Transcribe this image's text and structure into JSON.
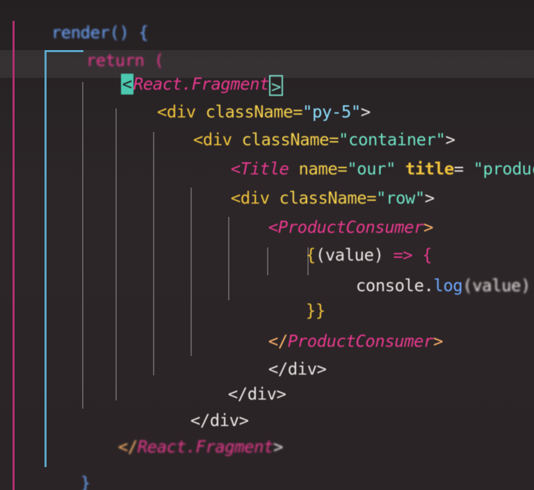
{
  "editor": {
    "lines": [
      {
        "id": "l1",
        "text": "render() {"
      },
      {
        "id": "l2",
        "text": "return ("
      },
      {
        "id": "l3a",
        "text": "<"
      },
      {
        "id": "l3b",
        "text": "React.Fragment"
      },
      {
        "id": "l3c",
        "text": ">"
      },
      {
        "id": "l4a",
        "text": "<div "
      },
      {
        "id": "l4b",
        "text": "className="
      },
      {
        "id": "l4c",
        "text": "\"py-5\""
      },
      {
        "id": "l4d",
        "text": ">"
      },
      {
        "id": "l5a",
        "text": "<div "
      },
      {
        "id": "l5b",
        "text": "className="
      },
      {
        "id": "l5c",
        "text": "\"container\""
      },
      {
        "id": "l5d",
        "text": ">"
      },
      {
        "id": "l6a",
        "text": "<"
      },
      {
        "id": "l6b",
        "text": "Title "
      },
      {
        "id": "l6c",
        "text": "name="
      },
      {
        "id": "l6d",
        "text": "\"our\""
      },
      {
        "id": "l6e",
        "text": " title"
      },
      {
        "id": "l6f",
        "text": "= "
      },
      {
        "id": "l6g",
        "text": "\"products\""
      },
      {
        "id": "l7a",
        "text": "<div "
      },
      {
        "id": "l7b",
        "text": "className="
      },
      {
        "id": "l7c",
        "text": "\"row\""
      },
      {
        "id": "l7d",
        "text": ">"
      },
      {
        "id": "l8a",
        "text": "<"
      },
      {
        "id": "l8b",
        "text": "ProductConsumer"
      },
      {
        "id": "l8c",
        "text": ">"
      },
      {
        "id": "l9a",
        "text": "{"
      },
      {
        "id": "l9b",
        "text": "(value) "
      },
      {
        "id": "l9c",
        "text": "=> "
      },
      {
        "id": "l9d",
        "text": "{"
      },
      {
        "id": "l10a",
        "text": "console"
      },
      {
        "id": "l10b",
        "text": "."
      },
      {
        "id": "l10c",
        "text": "log"
      },
      {
        "id": "l10d",
        "text": "(value)"
      },
      {
        "id": "l11",
        "text": "}}"
      },
      {
        "id": "l12a",
        "text": "</"
      },
      {
        "id": "l12b",
        "text": "ProductConsumer"
      },
      {
        "id": "l12c",
        "text": ">"
      },
      {
        "id": "l13",
        "text": "</div>"
      },
      {
        "id": "l14",
        "text": "</div>"
      },
      {
        "id": "l15",
        "text": "</div>"
      },
      {
        "id": "l16a",
        "text": "</"
      },
      {
        "id": "l16b",
        "text": "React.Fragment"
      },
      {
        "id": "l16c",
        "text": ">"
      },
      {
        "id": "l17",
        "text": "}"
      }
    ]
  },
  "colors": {
    "background": "#2a2426",
    "keyword": "#e83a8e",
    "tag": "#f0c33c",
    "string": "#6fe3c6",
    "function": "#6fa8ff",
    "component": "#e83a8e"
  }
}
